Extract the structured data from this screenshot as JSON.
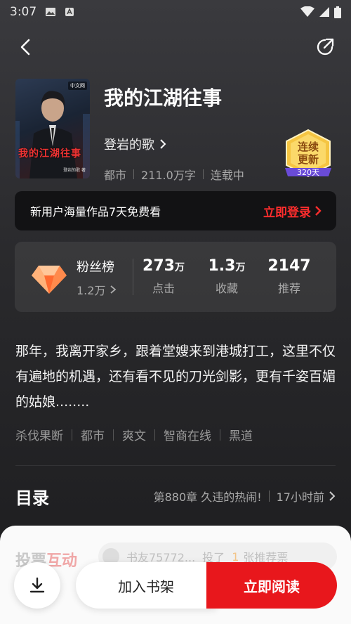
{
  "status_bar": {
    "time": "3:07"
  },
  "book": {
    "title": "我的江湖往事",
    "author": "登岩的歌",
    "category": "都市",
    "word_count": "211.0万字",
    "status": "连载中",
    "cover": {
      "title": "我的江湖往事",
      "badge": "中文网",
      "author_small": "登岩的歌 著"
    }
  },
  "update_badge": {
    "line1": "连续",
    "line2": "更新",
    "days": "320天"
  },
  "login_banner": {
    "text": "新用户海量作品7天免费看",
    "action": "立即登录"
  },
  "stats": {
    "fan_label": "粉丝榜",
    "fan_count": "1.2万",
    "clicks": {
      "value": "273",
      "unit": "万",
      "label": "点击"
    },
    "favorites": {
      "value": "1.3",
      "unit": "万",
      "label": "收藏"
    },
    "recommends": {
      "value": "2147",
      "unit": "",
      "label": "推荐"
    }
  },
  "intro": "那年，我离开家乡，跟着堂嫂来到港城打工，这里不仅有遍地的机遇，还有看不见的刀光剑影，更有千姿百媚的姑娘........",
  "tags": [
    "杀伐果断",
    "都市",
    "爽文",
    "智商在线",
    "黑道"
  ],
  "toc": {
    "title": "目录",
    "latest_chapter": "第880章 久违的热闹!",
    "updated": "17小时前"
  },
  "vote": {
    "title_part1": "投票",
    "title_part2": "互动",
    "ticker_user": "书友75772...",
    "ticker_action": "投了",
    "ticker_num": "1",
    "ticker_suffix": "张推荐票"
  },
  "actions": {
    "shelf": "加入书架",
    "read": "立即阅读"
  },
  "colors": {
    "accent_red": "#e8171c",
    "login_red": "#ff2d2d",
    "badge_gold": "#f5c542",
    "badge_purple": "#6a4bd8"
  }
}
